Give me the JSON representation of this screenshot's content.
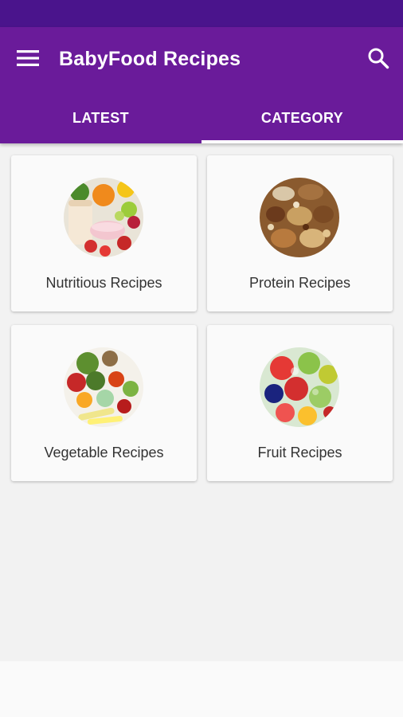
{
  "app": {
    "title": "BabyFood Recipes",
    "colors": {
      "status_bar": "#4a148c",
      "app_bar": "#6a1b9a",
      "background": "#f2f2f2",
      "card": "#fafafa"
    }
  },
  "header": {
    "menu_icon": "hamburger-menu-icon",
    "search_icon": "search-icon"
  },
  "tabs": [
    {
      "label": "LATEST",
      "selected": false
    },
    {
      "label": "CATEGORY",
      "selected": true
    }
  ],
  "categories": [
    {
      "name": "Nutritious Recipes",
      "icon": "nutritious-food-image"
    },
    {
      "name": "Protein Recipes",
      "icon": "nuts-image"
    },
    {
      "name": "Vegetable Recipes",
      "icon": "vegetables-image"
    },
    {
      "name": "Fruit Recipes",
      "icon": "fruits-image"
    }
  ]
}
